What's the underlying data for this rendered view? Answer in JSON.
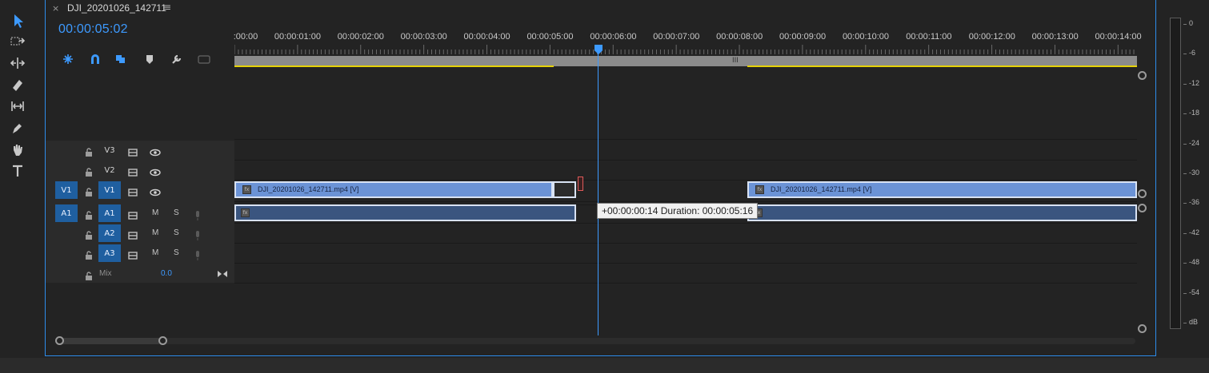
{
  "sequence": {
    "tab_title": "DJI_20201026_142711",
    "close_glyph": "×",
    "menu_glyph": "≡"
  },
  "timecode": "00:00:05:02",
  "ruler": {
    "labels": [
      ":00:00",
      "00:00:01:00",
      "00:00:02:00",
      "00:00:03:00",
      "00:00:04:00",
      "00:00:05:00",
      "00:00:06:00",
      "00:00:07:00",
      "00:00:08:00",
      "00:00:09:00",
      "00:00:10:00",
      "00:00:11:00",
      "00:00:12:00",
      "00:00:13:00",
      "00:00:14:00"
    ],
    "grip_glyph": "III"
  },
  "tracks": {
    "video": [
      {
        "name": "V3",
        "source": ""
      },
      {
        "name": "V2",
        "source": ""
      },
      {
        "name": "V1",
        "source": "V1"
      }
    ],
    "audio": [
      {
        "name": "A1",
        "source": "A1",
        "m": "M",
        "s": "S"
      },
      {
        "name": "A2",
        "source": "",
        "m": "M",
        "s": "S"
      },
      {
        "name": "A3",
        "source": "",
        "m": "M",
        "s": "S"
      }
    ],
    "mix": {
      "label": "Mix",
      "value": "0.0"
    }
  },
  "clips": {
    "video_label_1": "DJI_20201026_142711.mp4 [V]",
    "video_label_2": "DJI_20201026_142711.mp4 [V]",
    "fx": "fx"
  },
  "tooltip": "+00:00:00:14 Duration: 00:00:05:16",
  "meter": {
    "labels": [
      "0",
      "-6",
      "-12",
      "-18",
      "-24",
      "-30",
      "-36",
      "-42",
      "-48",
      "-54",
      "dB"
    ]
  },
  "colors": {
    "accent": "#3d9aff",
    "video_clip": "#6b93d6",
    "audio_clip": "#3a557f",
    "in_out": "#e6d200"
  },
  "icons": [
    "selection-tool-icon",
    "track-select-tool-icon",
    "ripple-edit-tool-icon",
    "razor-tool-icon",
    "slip-tool-icon",
    "pen-tool-icon",
    "hand-tool-icon",
    "type-tool-icon"
  ]
}
